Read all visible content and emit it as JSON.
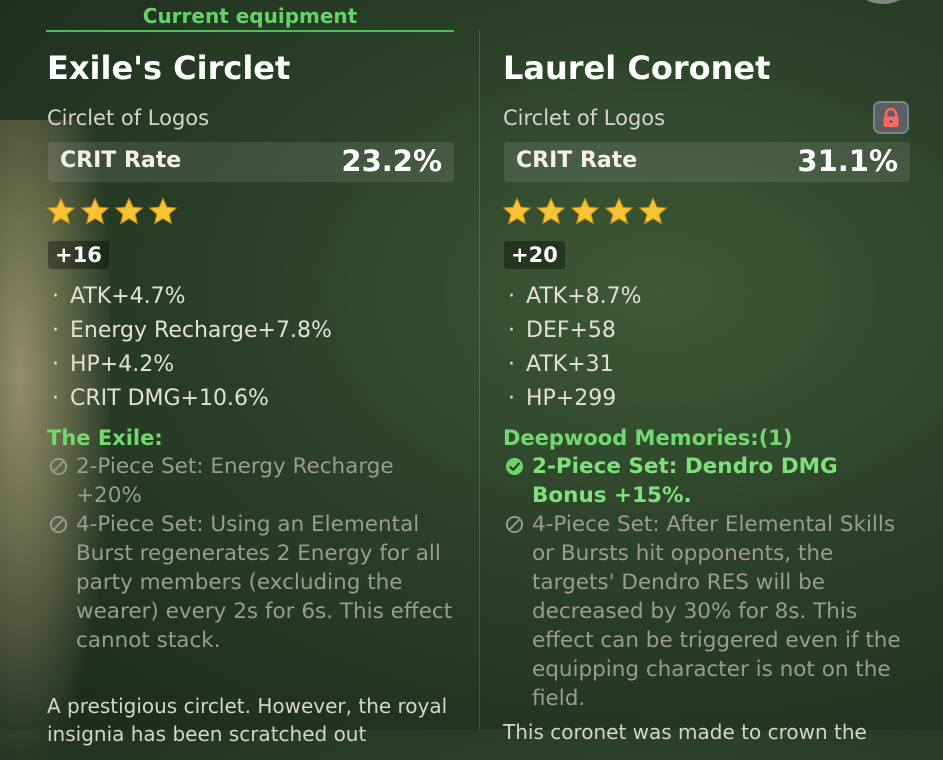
{
  "left": {
    "header_label": "Current equipment",
    "name": "Exile's Circlet",
    "type": "Circlet of Logos",
    "main_stat": {
      "label": "CRIT Rate",
      "value": "23.2%"
    },
    "rarity_stars": 4,
    "level": "+16",
    "substats": [
      "ATK+4.7%",
      "Energy Recharge+7.8%",
      "HP+4.2%",
      "CRIT DMG+10.6%"
    ],
    "set_name": "The Exile:",
    "set_bonuses": [
      {
        "text": "2-Piece Set: Energy Recharge +20%",
        "active": false
      },
      {
        "text": "4-Piece Set: Using an Elemental Burst regenerates 2 Energy for all party members (excluding the wearer) every 2s for 6s. This effect cannot stack.",
        "active": false
      }
    ],
    "flavor": "A prestigious circlet. However, the royal insignia has been scratched out"
  },
  "right": {
    "name": "Laurel Coronet",
    "type": "Circlet of Logos",
    "locked": true,
    "main_stat": {
      "label": "CRIT Rate",
      "value": "31.1%"
    },
    "rarity_stars": 5,
    "level": "+20",
    "substats": [
      "ATK+8.7%",
      "DEF+58",
      "ATK+31",
      "HP+299"
    ],
    "set_name": "Deepwood Memories:(1)",
    "set_bonuses": [
      {
        "text": "2-Piece Set: Dendro DMG Bonus +15%.",
        "active": true
      },
      {
        "text": "4-Piece Set: After Elemental Skills or Bursts hit opponents, the targets' Dendro RES will be decreased by 30% for 8s. This effect can be triggered even if the equipping character is not on the field.",
        "active": false
      }
    ],
    "flavor": "This coronet was made to crown the"
  },
  "colors": {
    "set_active": "#7fe07d",
    "set_name": "#71d96f",
    "set_inactive": "#9b9b93",
    "current_label": "#64d46a",
    "star": "#f7c233",
    "lock": "#ff6a5c"
  },
  "icons": {
    "star": "star-icon",
    "inactive": "prohibited-icon",
    "active": "check-circle-icon",
    "lock": "lock-icon"
  }
}
